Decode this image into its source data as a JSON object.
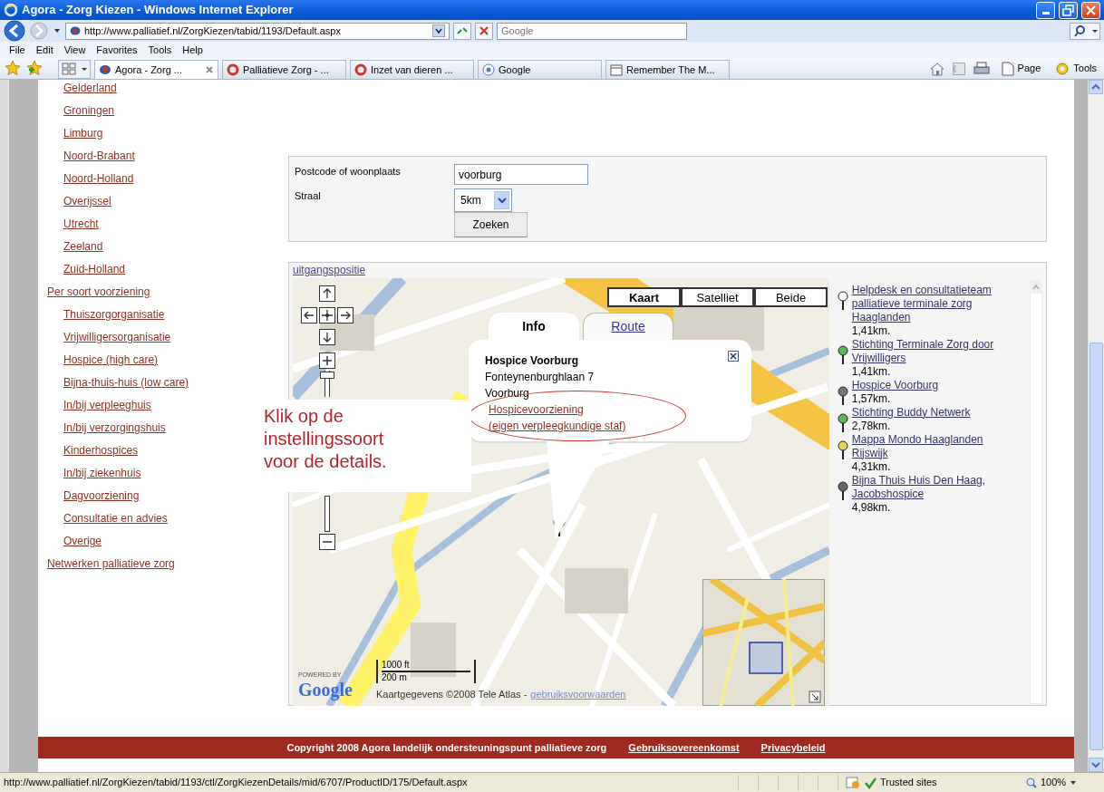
{
  "window": {
    "title": "Agora - Zorg Kiezen - Windows Internet Explorer"
  },
  "address_bar": {
    "url": "http://www.palliatief.nl/ZorgKiezen/tabid/1193/Default.aspx"
  },
  "search_box": {
    "placeholder": "Google"
  },
  "menu": [
    "File",
    "Edit",
    "View",
    "Favorites",
    "Tools",
    "Help"
  ],
  "tabs": [
    {
      "label": "Agora - Zorg ...",
      "selected": true
    },
    {
      "label": "Palliatieve Zorg - ...",
      "selected": false
    },
    {
      "label": "Inzet van dieren ...",
      "selected": false
    },
    {
      "label": "Google",
      "selected": false
    },
    {
      "label": "Remember The M...",
      "selected": false
    }
  ],
  "toolbar_buttons": [
    "Page",
    "Tools"
  ],
  "sidebar": {
    "groups": [
      {
        "children": [
          "Gelderland",
          "Groningen",
          "Limburg",
          "Noord-Brabant",
          "Noord-Holland",
          "Overijssel",
          "Utrecht",
          "Zeeland",
          "Zuid-Holland"
        ]
      },
      {
        "label": "Per soort voorziening",
        "children": [
          "Thuiszorgorganisatie",
          "Vrijwilligersorganisatie",
          "Hospice (high care)",
          "Bijna-thuis-huis (low care)",
          "In/bij verpleeghuis",
          "In/bij verzorgingshuis",
          "Kinderhospices",
          "In/bij ziekenhuis",
          "Dagvoorziening",
          "Consultatie en advies",
          "Overige"
        ]
      },
      {
        "label": "Netwerken palliatieve zorg"
      }
    ]
  },
  "search_form": {
    "postcode_label": "Postcode of woonplaats",
    "postcode_value": "voorburg",
    "radius_label": "Straal",
    "radius_value": "5km",
    "submit": "Zoeken"
  },
  "map": {
    "reset_link": "uitgangspositie",
    "map_types": [
      {
        "label": "Kaart",
        "selected": true
      },
      {
        "label": "Satelliet",
        "selected": false
      },
      {
        "label": "Beide",
        "selected": false
      }
    ],
    "zoom_slider": {
      "level": 0.93
    },
    "info_window": {
      "tabs": [
        {
          "label": "Info",
          "selected": true
        },
        {
          "label": "Route",
          "selected": false
        }
      ],
      "title": "Hospice Voorburg",
      "address_lines": [
        "Fonteynenburghlaan 7",
        "Voorburg"
      ],
      "link_lines": [
        "Hospicevoorziening",
        "(eigen verpleegkundige staf)"
      ]
    },
    "powered_by": "POWERED BY",
    "logo": "Google",
    "scale_labels": [
      "1000 ft",
      "200 m"
    ],
    "attribution": "Kaartgegevens ©2008 Tele Atlas -",
    "terms_link": "gebruiksvoorwaarden"
  },
  "callout": {
    "lines": [
      "Klik op de",
      "instellingssoort",
      "voor de details."
    ]
  },
  "results": [
    {
      "name": "Helpdesk en consultatieteam palliatieve terminale zorg Haaglanden",
      "distance": "1,41km.",
      "color": "#ffffff"
    },
    {
      "name": "Stichting Terminale Zorg door Vrijwilligers",
      "distance": "1,41km.",
      "color": "#5cb85c"
    },
    {
      "name": "Hospice Voorburg",
      "distance": "1,57km.",
      "color": "#777777"
    },
    {
      "name": "Stichting Buddy Netwerk",
      "distance": "2,78km.",
      "color": "#5cb85c"
    },
    {
      "name": "Mappa Mondo Haaglanden Rijswijk",
      "distance": "4,31km.",
      "color": "#e6d35a"
    },
    {
      "name": "Bijna Thuis Huis Den Haag, Jacobshospice",
      "distance": "4,98km.",
      "color": "#666666"
    }
  ],
  "footer": {
    "copyright": "Copyright 2008 Agora landelijk ondersteuningspunt palliatieve zorg",
    "links": [
      "Gebruiksovereenkomst",
      "Privacybeleid"
    ]
  },
  "status_bar": {
    "url": "http://www.palliatief.nl/ZorgKiezen/tabid/1193/ctl/ZorgKiezenDetails/mid/6707/ProductID/175/Default.aspx",
    "zone": "Trusted sites",
    "zoom": "100%"
  }
}
